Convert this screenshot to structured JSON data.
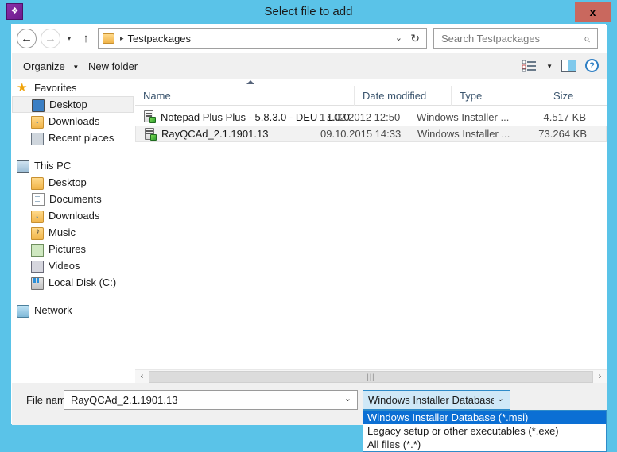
{
  "window": {
    "title": "Select file to add",
    "app_icon": "app-icon",
    "close_label": "x",
    "titlebar_color": "#5ac3e8",
    "close_button_color": "#c9685e"
  },
  "nav": {
    "back_icon": "←",
    "forward_icon": "→",
    "recent_icon": "▾",
    "up_icon": "↑",
    "address": {
      "crumb": "Testpackages",
      "separator": "▸",
      "chevron": "⌄",
      "refresh": "↻"
    },
    "search": {
      "placeholder": "Search Testpackages",
      "value": "",
      "icon": "⌕"
    }
  },
  "commandbar": {
    "organize_label": "Organize",
    "organize_caret": "▼",
    "newfolder_label": "New folder",
    "view_caret": "▼",
    "help_label": "?"
  },
  "sidebar": {
    "groups": [
      {
        "header": {
          "label": "Favorites",
          "icon": "star-icon"
        },
        "items": [
          {
            "label": "Desktop",
            "icon": "monitor-icon",
            "selected": true
          },
          {
            "label": "Downloads",
            "icon": "folder-download-icon",
            "selected": false
          },
          {
            "label": "Recent places",
            "icon": "recent-places-icon",
            "selected": false
          }
        ]
      },
      {
        "header": {
          "label": "This PC",
          "icon": "computer-icon"
        },
        "items": [
          {
            "label": "Desktop",
            "icon": "folder-desktop-icon",
            "selected": false
          },
          {
            "label": "Documents",
            "icon": "folder-documents-icon",
            "selected": false
          },
          {
            "label": "Downloads",
            "icon": "folder-download-icon",
            "selected": false
          },
          {
            "label": "Music",
            "icon": "folder-music-icon",
            "selected": false
          },
          {
            "label": "Pictures",
            "icon": "folder-pictures-icon",
            "selected": false
          },
          {
            "label": "Videos",
            "icon": "folder-videos-icon",
            "selected": false
          },
          {
            "label": "Local Disk (C:)",
            "icon": "disk-icon",
            "selected": false
          }
        ]
      },
      {
        "header": {
          "label": "Network",
          "icon": "network-icon"
        },
        "items": []
      }
    ]
  },
  "filelist": {
    "columns": [
      {
        "label": "Name"
      },
      {
        "label": "Date modified"
      },
      {
        "label": "Type"
      },
      {
        "label": "Size"
      }
    ],
    "sort_column": "Name",
    "sort_direction": "asc",
    "rows": [
      {
        "icon": "msi-file-icon",
        "name": "Notepad Plus Plus - 5.8.3.0 - DEU - 1.0.0",
        "date_modified": "17.02.2012 12:50",
        "type": "Windows Installer ...",
        "size": "4.517 KB",
        "selected": false
      },
      {
        "icon": "msi-file-icon",
        "name": "RayQCAd_2.1.1901.13",
        "date_modified": "09.10.2015 14:33",
        "type": "Windows Installer ...",
        "size": "73.264 KB",
        "selected": true
      }
    ],
    "scrollbar": {
      "left_arrow": "‹",
      "right_arrow": "›",
      "grip": "|||"
    }
  },
  "bottom": {
    "filename_label": "File name:",
    "filename_value": "RayQCAd_2.1.1901.13",
    "filename_placeholder": "",
    "filename_caret": "⌄",
    "filter": {
      "selected_display": "Windows Installer Database (*.r",
      "caret": "⌄",
      "open": true,
      "options": [
        {
          "label": "Windows Installer Database (*.msi)",
          "selected": true
        },
        {
          "label": "Legacy setup or other executables (*.exe)",
          "selected": false
        },
        {
          "label": "All files (*.*)",
          "selected": false
        }
      ]
    }
  }
}
